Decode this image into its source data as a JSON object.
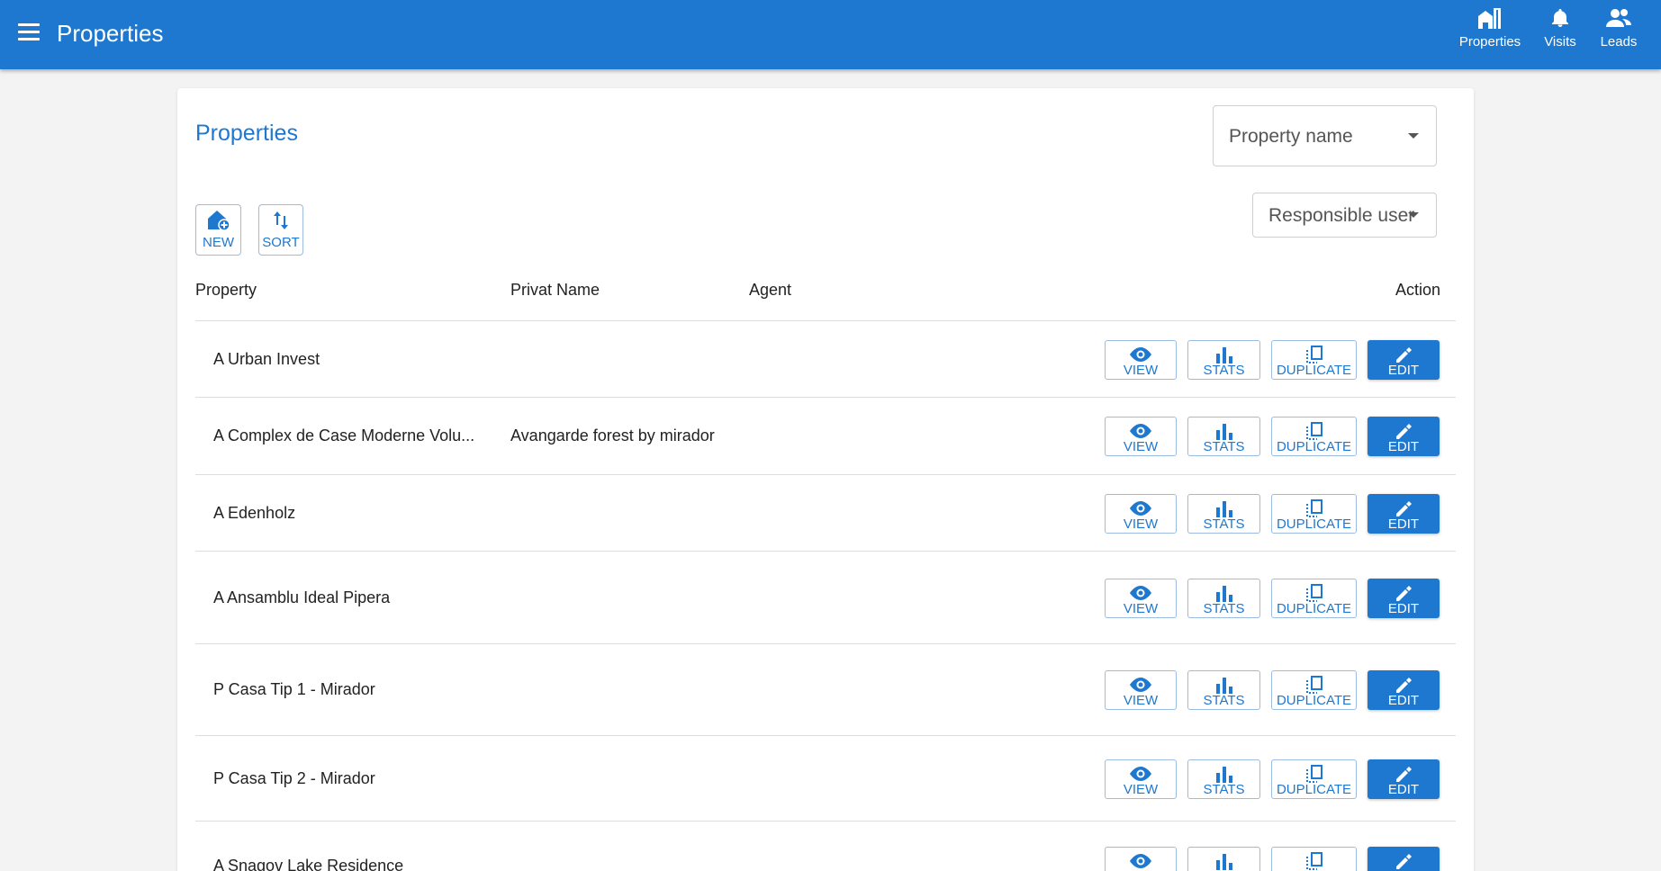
{
  "app": {
    "title": "Properties"
  },
  "nav": [
    {
      "label": "Properties",
      "icon": "buildings-icon"
    },
    {
      "label": "Visits",
      "icon": "bell-icon"
    },
    {
      "label": "Leads",
      "icon": "people-icon"
    }
  ],
  "page": {
    "title": "Properties"
  },
  "filters": {
    "property_name": {
      "placeholder": "Property name"
    },
    "responsible_user": {
      "placeholder": "Responsible user"
    }
  },
  "toolbar": {
    "new_label": "NEW",
    "sort_label": "SORT"
  },
  "table": {
    "headers": {
      "property": "Property",
      "privat_name": "Privat Name",
      "agent": "Agent",
      "action": "Action"
    },
    "rows": [
      {
        "property": "A Urban Invest",
        "privat_name": "",
        "agent": ""
      },
      {
        "property": "A Complex de Case Moderne Volu...",
        "privat_name": "Avangarde forest by mirador",
        "agent": ""
      },
      {
        "property": "A Edenholz",
        "privat_name": "",
        "agent": ""
      },
      {
        "property": "A Ansamblu Ideal Pipera",
        "privat_name": "",
        "agent": ""
      },
      {
        "property": "P Casa Tip 1 - Mirador",
        "privat_name": "",
        "agent": ""
      },
      {
        "property": "P Casa Tip 2 - Mirador",
        "privat_name": "",
        "agent": ""
      },
      {
        "property": "A Snagov Lake Residence",
        "privat_name": "",
        "agent": ""
      }
    ]
  },
  "actions": {
    "view": "VIEW",
    "stats": "STATS",
    "duplicate": "DUPLICATE",
    "edit": "EDIT"
  },
  "colors": {
    "primary": "#1e78cf",
    "background": "#f3f3f3"
  }
}
